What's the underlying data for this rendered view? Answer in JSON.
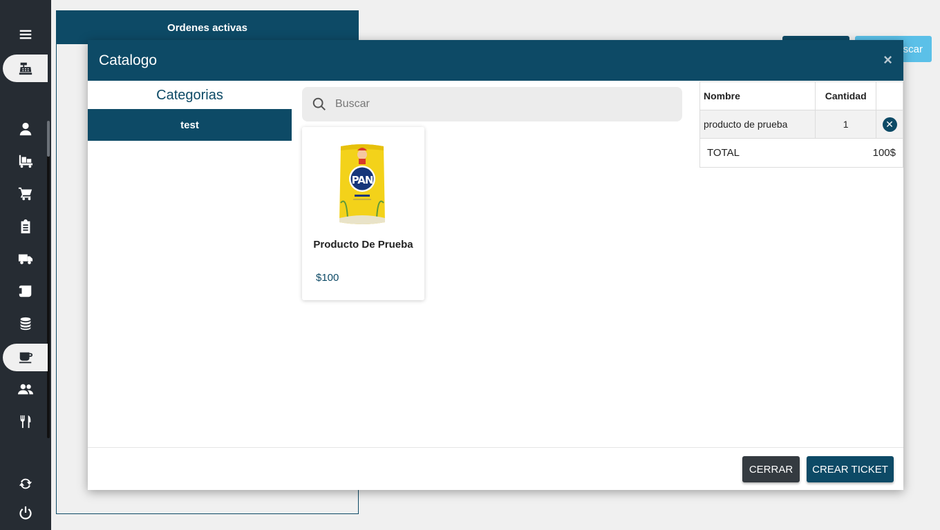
{
  "sidebar": {
    "icons": [
      "menu-icon",
      "cash-register-icon",
      "user-icon",
      "warehouse-icon",
      "cart-icon",
      "clipboard-icon",
      "truck-icon",
      "scroll-icon",
      "coins-icon",
      "coffee-icon",
      "users-icon",
      "utensils-icon",
      "sync-icon",
      "power-icon"
    ]
  },
  "background": {
    "orders_title": "Ordenes activas",
    "search_button_label": "Buscar"
  },
  "modal": {
    "title": "Catalogo",
    "close_symbol": "×",
    "categories_title": "Categorias",
    "categories": [
      "test"
    ],
    "search_placeholder": "Buscar",
    "products": [
      {
        "name": "Producto De Prueba",
        "price": "$100",
        "image_label": "PAN"
      }
    ],
    "cart": {
      "headers": {
        "name": "Nombre",
        "quantity": "Cantidad"
      },
      "items": [
        {
          "name": "producto de prueba",
          "quantity": "1"
        }
      ],
      "total_label": "TOTAL",
      "total_value": "100$"
    },
    "buttons": {
      "close": "CERRAR",
      "create": "CREAR TICKET"
    }
  },
  "colors": {
    "primary": "#0d4a66",
    "sidebar": "#262c33",
    "info": "#5bc0e8",
    "dark_button": "#343a40"
  }
}
